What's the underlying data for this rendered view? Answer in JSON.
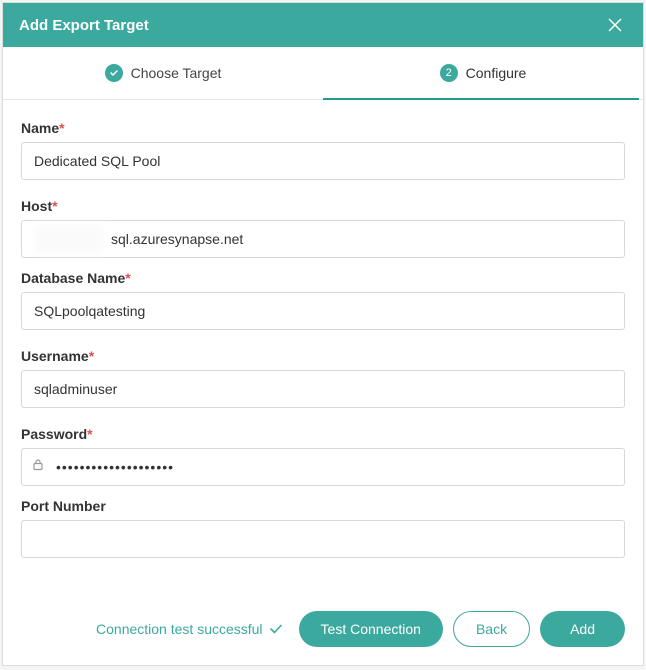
{
  "header": {
    "title": "Add Export Target"
  },
  "stepper": {
    "step1": {
      "label": "Choose Target"
    },
    "step2": {
      "num": "2",
      "label": "Configure"
    }
  },
  "fields": {
    "name": {
      "label": "Name",
      "required": true,
      "value": "Dedicated SQL Pool"
    },
    "host": {
      "label": "Host",
      "required": true,
      "value": "sql.azuresynapse.net"
    },
    "db": {
      "label": "Database Name",
      "required": true,
      "value": "SQLpoolqatesting"
    },
    "user": {
      "label": "Username",
      "required": true,
      "value": "sqladminuser"
    },
    "pass": {
      "label": "Password",
      "required": true,
      "value": "••••••••••••••••••••"
    },
    "port": {
      "label": "Port Number",
      "required": false,
      "value": ""
    }
  },
  "footer": {
    "status": "Connection test successful",
    "test": "Test Connection",
    "back": "Back",
    "add": "Add"
  }
}
